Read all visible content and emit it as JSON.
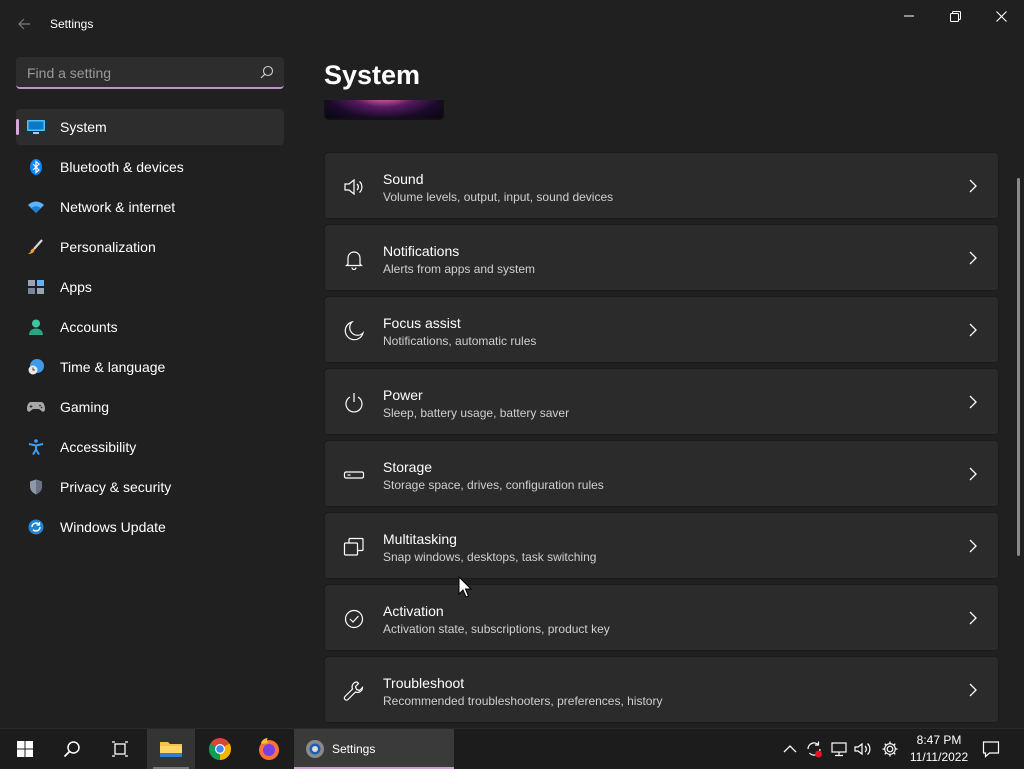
{
  "window": {
    "title": "Settings"
  },
  "search": {
    "placeholder": "Find a setting"
  },
  "sidebar": {
    "items": [
      {
        "label": "System",
        "icon": "monitor-icon",
        "active": true
      },
      {
        "label": "Bluetooth & devices",
        "icon": "bluetooth-icon"
      },
      {
        "label": "Network & internet",
        "icon": "wifi-icon"
      },
      {
        "label": "Personalization",
        "icon": "brush-icon"
      },
      {
        "label": "Apps",
        "icon": "apps-icon"
      },
      {
        "label": "Accounts",
        "icon": "person-icon"
      },
      {
        "label": "Time & language",
        "icon": "globe-clock-icon"
      },
      {
        "label": "Gaming",
        "icon": "controller-icon"
      },
      {
        "label": "Accessibility",
        "icon": "accessibility-icon"
      },
      {
        "label": "Privacy & security",
        "icon": "shield-icon"
      },
      {
        "label": "Windows Update",
        "icon": "update-icon"
      }
    ]
  },
  "main": {
    "title": "System",
    "cards": [
      {
        "title": "Sound",
        "subtitle": "Volume levels, output, input, sound devices",
        "icon": "speaker-icon"
      },
      {
        "title": "Notifications",
        "subtitle": "Alerts from apps and system",
        "icon": "bell-icon"
      },
      {
        "title": "Focus assist",
        "subtitle": "Notifications, automatic rules",
        "icon": "moon-icon"
      },
      {
        "title": "Power",
        "subtitle": "Sleep, battery usage, battery saver",
        "icon": "power-icon"
      },
      {
        "title": "Storage",
        "subtitle": "Storage space, drives, configuration rules",
        "icon": "drive-icon"
      },
      {
        "title": "Multitasking",
        "subtitle": "Snap windows, desktops, task switching",
        "icon": "multitask-icon"
      },
      {
        "title": "Activation",
        "subtitle": "Activation state, subscriptions, product key",
        "icon": "check-circle-icon"
      },
      {
        "title": "Troubleshoot",
        "subtitle": "Recommended troubleshooters, preferences, history",
        "icon": "wrench-icon"
      }
    ]
  },
  "taskbar": {
    "settings_label": "Settings",
    "time": "8:47 PM",
    "date": "11/11/2022"
  },
  "colors": {
    "accent": "#c293c9",
    "background": "#202020",
    "card": "#2b2b2b",
    "taskbar": "#1c1c1c"
  }
}
